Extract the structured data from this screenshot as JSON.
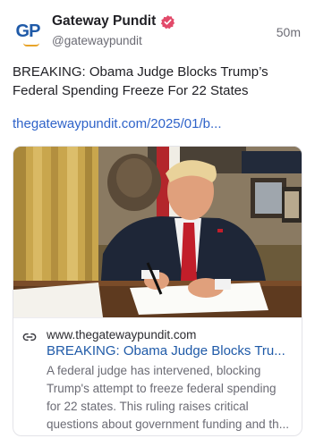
{
  "colors": {
    "accent_link": "#2f63c9",
    "card_title": "#1f5aa8",
    "verified_badge": "#e24a6a",
    "muted_text": "#6b6b74"
  },
  "author": {
    "avatar_text": "GP",
    "display_name": "Gateway Pundit",
    "handle": "@gatewaypundit",
    "verified_icon": "verified-badge-icon"
  },
  "post": {
    "time": "50m",
    "text_line1": "BREAKING: Obama Judge Blocks Trump’s",
    "text_line2": "Federal Spending Freeze For 22 States",
    "link": "thegatewaypundit.com/2025/01/b..."
  },
  "card": {
    "image_alt": "Man in suit signing documents at a desk in the Oval Office",
    "link_icon": "link-icon",
    "domain": "www.thegatewaypundit.com",
    "title": "BREAKING: Obama Judge Blocks Tru...",
    "desc_lines": [
      "A federal judge has intervened, blocking",
      "Trump's attempt to freeze federal spending",
      "for 22 states. This ruling raises critical",
      "questions about government funding and th..."
    ]
  }
}
